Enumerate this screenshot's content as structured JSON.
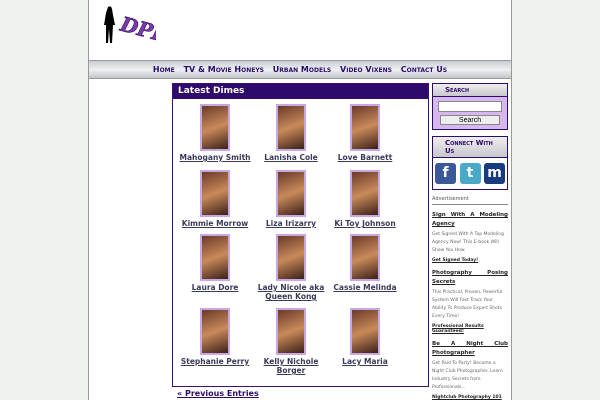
{
  "logo_text": "DPH",
  "nav": [
    "Home",
    "TV & Movie Honeys",
    "Urban Models",
    "Video Vixens",
    "Contact Us"
  ],
  "main": {
    "title": "Latest Dimes",
    "models": [
      "Mahogany Smith",
      "Lanisha Cole",
      "Love Barnett",
      "Kimmie Morrow",
      "Liza Irizarry",
      "Ki Toy Johnson",
      "Laura Dore",
      "Lady Nicole aka Queen Kong",
      "Cassie Melinda",
      "Stephanie Perry",
      "Kelly Nichole Borger",
      "Lacy Maria"
    ],
    "prev": "« Previous Entries"
  },
  "sidebar": {
    "search_title": "Search",
    "search_button": "Search",
    "connect_title": "Connect With Us",
    "social": [
      "facebook-icon",
      "twitter-icon",
      "myspace-icon"
    ],
    "ad_label": "Advertisement",
    "ads": [
      {
        "title": "Sign With A Modeling Agency",
        "body": "Get Signed With A Top Modeling Agency Now! This E-book Will Show You How.",
        "link": "Get Signed Today!"
      },
      {
        "title": "Photography Posing Secrets",
        "body": "This Practical, Proven, Powerful System Will Fast Track Your Ability To Produce Expert Shots Every Time!",
        "link": "Professional Results Guaranteed!"
      },
      {
        "title": "Be A Night Club Photographer",
        "body": "Get Paid To Party! Become a Night Club Photographer. Learn Industry Secrets from Professionals...",
        "link": "Nightclub Photography 101"
      }
    ]
  },
  "colors": {
    "accent": "#2e0a6a",
    "search_bg": "#d6b8ee"
  }
}
